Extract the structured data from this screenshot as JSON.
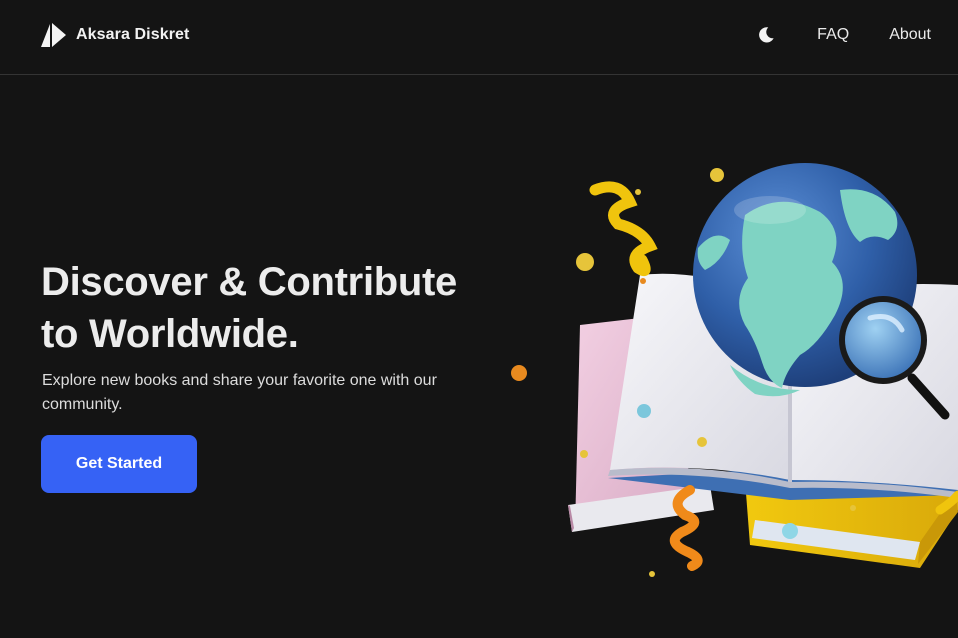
{
  "navbar": {
    "brand_name": "Aksara Diskret",
    "links": {
      "faq": "FAQ",
      "about": "About"
    },
    "theme_icon": "moon-icon"
  },
  "hero": {
    "title_line1": "Discover & Contribute",
    "title_line2": "to Worldwide.",
    "subtitle": "Explore new books and share your favorite one with our community.",
    "cta_label": "Get Started"
  },
  "illustration": {
    "subject": "3d-globe-on-open-books-with-magnifier"
  },
  "colors": {
    "background": "#141414",
    "text": "#ececec",
    "accent": "#3662f5",
    "divider": "#343434"
  }
}
